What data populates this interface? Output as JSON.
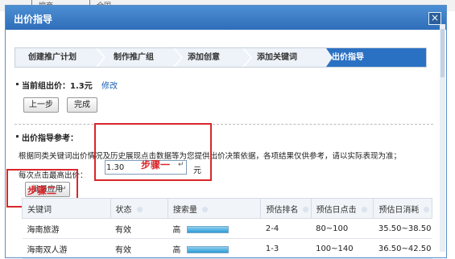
{
  "background": {
    "items": [
      "|",
      "搜商",
      "|",
      "全国"
    ]
  },
  "dialog": {
    "title": "出价指导",
    "close_glyph": "×"
  },
  "steps": [
    "创建推广计划",
    "制作推广组",
    "添加创意",
    "添加关键词",
    "出价指导"
  ],
  "current_bid": {
    "label": "当前组出价：1.3元",
    "modify_link": "修改"
  },
  "buttons": {
    "back": "上一步",
    "done": "完成",
    "apply": "批量应用"
  },
  "reference": {
    "heading": "出价指导参考：",
    "description": "根据同类关键词出价情况及历史展现点击数据等为您提供出价决策依据，各项结果仅供参考，请以实际表现为准；",
    "bid_label": "每次点击最高出价：",
    "bid_value": "1.30",
    "unit": "元"
  },
  "annotations": {
    "step1": "步骤一",
    "step2": "步骤二",
    "enter_mark": "↵"
  },
  "table": {
    "headers": [
      "关键词",
      "状态",
      "搜索量",
      "预估排名",
      "预估日点击",
      "预估日消耗"
    ],
    "rows": [
      {
        "keyword": "海南旅游",
        "status": "有效",
        "volume": "高",
        "rank": "2-4",
        "clicks": "80~100",
        "cost": "35.50~38.50"
      },
      {
        "keyword": "海南双人游",
        "status": "有效",
        "volume": "高",
        "rank": "1-3",
        "clicks": "100~140",
        "cost": "36.50~42.50"
      }
    ]
  },
  "colors": {
    "accent": "#2b71c3",
    "annotation_red": "#d9262a"
  }
}
